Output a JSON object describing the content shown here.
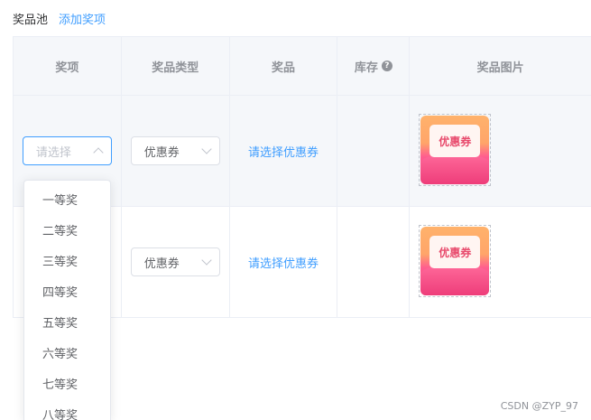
{
  "header": {
    "title": "奖品池",
    "add_link": "添加奖项"
  },
  "table": {
    "columns": [
      "奖项",
      "奖品类型",
      "奖品",
      "库存",
      "奖品图片"
    ],
    "help_icon": "question-circle-icon",
    "rows": [
      {
        "award_placeholder": "请选择",
        "prize_type": "优惠券",
        "prize_link": "请选择优惠券",
        "stock": "",
        "image_text": "优惠券"
      },
      {
        "award_placeholder": "",
        "prize_type": "优惠券",
        "prize_link": "请选择优惠券",
        "stock": "",
        "image_text": "优惠券"
      }
    ]
  },
  "dropdown": {
    "items": [
      "一等奖",
      "二等奖",
      "三等奖",
      "四等奖",
      "五等奖",
      "六等奖",
      "七等奖",
      "八等奖"
    ]
  },
  "watermark": "CSDN @ZYP_97",
  "colors": {
    "accent": "#409eff",
    "header_bg": "#f5f7fa",
    "border": "#ebeef5"
  }
}
